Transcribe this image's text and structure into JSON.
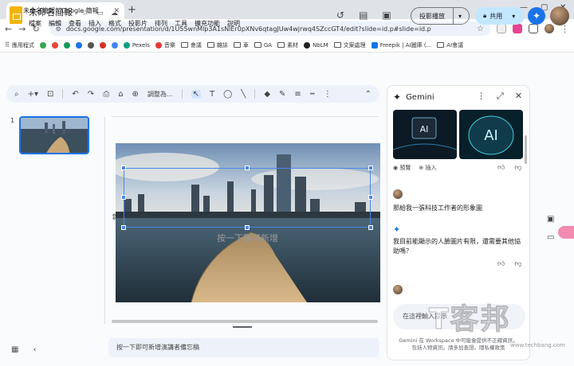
{
  "browser": {
    "tab_title": "未命名簡報 - Google 簡報",
    "url": "docs.google.com/presentation/d/1U55wnMlp3A1sNlEr0pXNv6qtagJUw4wjrwq4SZccGT4/edit?slide=id.p#slide=id.p",
    "bookmarks": [
      "應用程式",
      "Pexels",
      "音樂",
      "會議",
      "雜誌",
      "車",
      "GA",
      "素材",
      "NbLM",
      "文案處理",
      "Freepik | AI圖庫 (...",
      "AI會議"
    ]
  },
  "docs": {
    "title": "未命名簡報",
    "menu": [
      "檔案",
      "編輯",
      "查看",
      "插入",
      "格式",
      "投影片",
      "排列",
      "工具",
      "擴充功能",
      "說明"
    ],
    "present_label": "投影播放",
    "share_label": "共用",
    "toolbar_zoom": "調整為..."
  },
  "filmstrip": {
    "slide_number": "1"
  },
  "canvas": {
    "subtitle_placeholder": "按一下即可新增",
    "notes_placeholder": "按一下即可新增演講者備忘稿"
  },
  "gemini": {
    "title": "Gemini",
    "preview_label": "預覽",
    "insert_label": "插入",
    "user_msg_1": "那給我一張科技工作者的形象圖",
    "reply_msg": "我目前能顯示的人臉圖片有限，還需要其他協助嗎？",
    "prompt_placeholder": "在這裡輸入提示",
    "disclaimer": "Gemini 在 Workspace 中可能會提供不正確資訊，包括人物資訊。請多加查證。隱私權政策"
  },
  "watermark": {
    "logo_text": "T客邦",
    "url": "www.techbang.com"
  },
  "colors": {
    "accent": "#1a73e8",
    "share_bg": "#c2e7ff",
    "slides_yellow": "#f4b400"
  }
}
